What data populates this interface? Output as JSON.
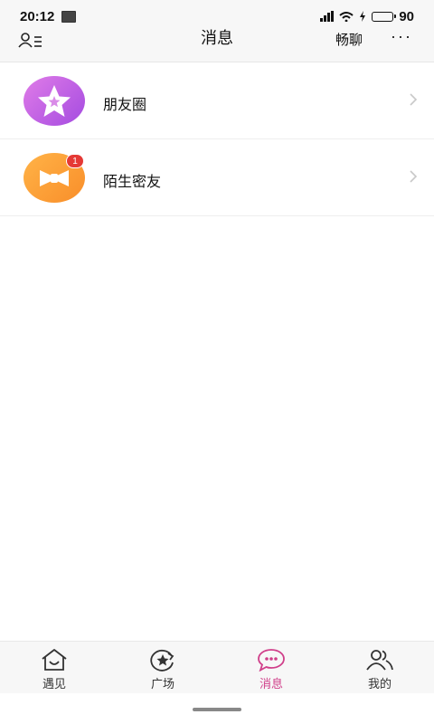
{
  "status_bar": {
    "time": "20:12",
    "battery_level": "90",
    "battery_color": "#22c02a"
  },
  "nav": {
    "title": "消息",
    "chat_label": "畅聊",
    "more_label": "···"
  },
  "messages": [
    {
      "label": "朋友圈",
      "icon": "star-icon",
      "color": "#b459e4",
      "badge": ""
    },
    {
      "label": "陌生密友",
      "icon": "bowtie-icon",
      "color": "#f9a23a",
      "badge": "1"
    }
  ],
  "tabs": [
    {
      "label": "遇见",
      "icon": "home-smile-icon",
      "active": false
    },
    {
      "label": "广场",
      "icon": "refresh-star-icon",
      "active": false
    },
    {
      "label": "消息",
      "icon": "chat-bubble-icon",
      "active": true
    },
    {
      "label": "我的",
      "icon": "people-icon",
      "active": false
    }
  ],
  "colors": {
    "accent": "#d03f8a",
    "badge": "#e53935"
  }
}
